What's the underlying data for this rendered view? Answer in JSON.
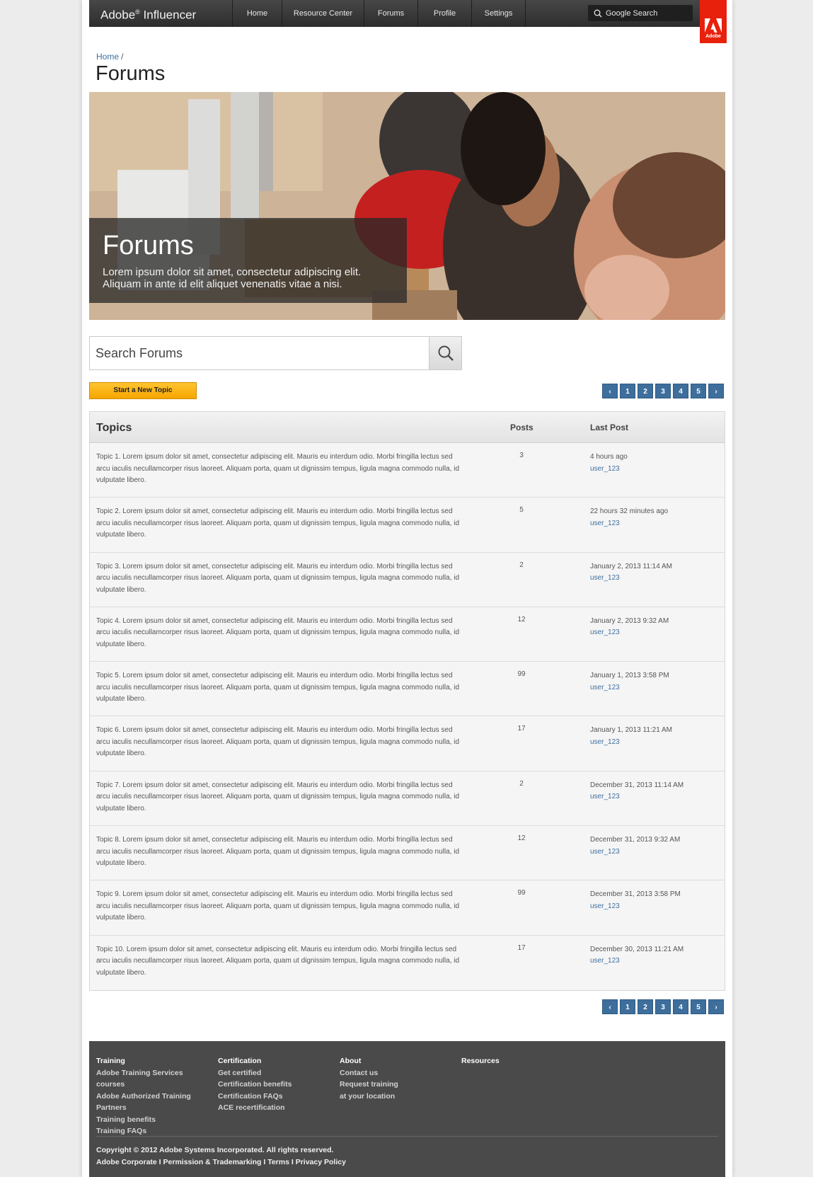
{
  "topbar": {
    "brand": "Adobe",
    "brand_reg": "®",
    "brand_suffix": " Influencer",
    "nav": [
      "Home",
      "Resource Center",
      "Forums",
      "Profile",
      "Settings"
    ],
    "search_label": "Google Search",
    "adobe_badge": "Adobe"
  },
  "breadcrumb": {
    "home": "Home",
    "separator": "/"
  },
  "page_title": "Forums",
  "hero": {
    "title": "Forums",
    "text": "Lorem ipsum dolor sit amet, consectetur adipiscing elit. Aliquam in ante id elit aliquet venenatis vitae a nisi."
  },
  "search": {
    "placeholder": "Search Forums"
  },
  "new_topic_label": "Start a New Topic",
  "pager": {
    "prev": "‹",
    "pages": [
      "1",
      "2",
      "3",
      "4",
      "5"
    ],
    "next": "›"
  },
  "table": {
    "headers": {
      "topics": "Topics",
      "posts": "Posts",
      "last_post": "Last Post"
    },
    "rows": [
      {
        "topic": "Topic 1. Lorem ipsum dolor sit amet, consectetur adipiscing elit. Mauris eu interdum odio. Morbi fringilla lectus sed arcu iaculis necullamcorper risus laoreet. Aliquam porta, quam ut dignissim tempus, ligula magna commodo nulla, id vulputate libero.",
        "posts": "3",
        "time": "4 hours ago",
        "user": "user_123"
      },
      {
        "topic": "Topic 2. Lorem ipsum dolor sit amet, consectetur adipiscing elit. Mauris eu interdum odio. Morbi fringilla lectus sed arcu iaculis necullamcorper risus laoreet. Aliquam porta, quam ut dignissim tempus, ligula magna commodo nulla, id vulputate libero.",
        "posts": "5",
        "time": "22 hours 32 minutes ago",
        "user": "user_123"
      },
      {
        "topic": "Topic 3. Lorem ipsum dolor sit amet, consectetur adipiscing elit. Mauris eu interdum odio. Morbi fringilla lectus sed arcu iaculis necullamcorper risus laoreet. Aliquam porta, quam ut dignissim tempus, ligula magna commodo nulla, id vulputate libero.",
        "posts": "2",
        "time": "January 2, 2013 11:14 AM",
        "user": "user_123"
      },
      {
        "topic": "Topic 4. Lorem ipsum dolor sit amet, consectetur adipiscing elit. Mauris eu interdum odio. Morbi fringilla lectus sed arcu iaculis necullamcorper risus laoreet. Aliquam porta, quam ut dignissim tempus, ligula magna commodo nulla, id vulputate libero.",
        "posts": "12",
        "time": "January 2, 2013 9:32 AM",
        "user": "user_123"
      },
      {
        "topic": "Topic 5. Lorem ipsum dolor sit amet, consectetur adipiscing elit. Mauris eu interdum odio. Morbi fringilla lectus sed arcu iaculis necullamcorper risus laoreet. Aliquam porta, quam ut dignissim tempus, ligula magna commodo nulla, id vulputate libero.",
        "posts": "99",
        "time": "January 1, 2013 3:58 PM",
        "user": "user_123"
      },
      {
        "topic": "Topic 6. Lorem ipsum dolor sit amet, consectetur adipiscing elit. Mauris eu interdum odio. Morbi fringilla lectus sed arcu iaculis necullamcorper risus laoreet. Aliquam porta, quam ut dignissim tempus, ligula magna commodo nulla, id vulputate libero.",
        "posts": "17",
        "time": "January 1, 2013 11:21 AM",
        "user": "user_123"
      },
      {
        "topic": "Topic 7. Lorem ipsum dolor sit amet, consectetur adipiscing elit. Mauris eu interdum odio. Morbi fringilla lectus sed arcu iaculis necullamcorper risus laoreet. Aliquam porta, quam ut dignissim tempus, ligula magna commodo nulla, id vulputate libero.",
        "posts": "2",
        "time": "December 31, 2013 11:14 AM",
        "user": "user_123"
      },
      {
        "topic": "Topic 8. Lorem ipsum dolor sit amet, consectetur adipiscing elit. Mauris eu interdum odio. Morbi fringilla lectus sed arcu iaculis necullamcorper risus laoreet. Aliquam porta, quam ut dignissim tempus, ligula magna commodo nulla, id vulputate libero.",
        "posts": "12",
        "time": "December 31, 2013 9:32 AM",
        "user": "user_123"
      },
      {
        "topic": "Topic 9. Lorem ipsum dolor sit amet, consectetur adipiscing elit. Mauris eu interdum odio. Morbi fringilla lectus sed arcu iaculis necullamcorper risus laoreet. Aliquam porta, quam ut dignissim tempus, ligula magna commodo nulla, id vulputate libero.",
        "posts": "99",
        "time": "December 31, 2013 3:58 PM",
        "user": "user_123"
      },
      {
        "topic": "Topic 10. Lorem ipsum dolor sit amet, consectetur adipiscing elit. Mauris eu interdum odio. Morbi fringilla lectus sed arcu iaculis necullamcorper risus laoreet. Aliquam porta, quam ut dignissim tempus, ligula magna commodo nulla, id vulputate libero.",
        "posts": "17",
        "time": "December 30, 2013 11:21 AM",
        "user": "user_123"
      }
    ]
  },
  "footer": {
    "training": {
      "heading": "Training",
      "links": [
        "Adobe Training Services courses",
        "Adobe Authorized Training Partners",
        "Training benefits",
        "Training FAQs"
      ]
    },
    "certification": {
      "heading": "Certification",
      "links": [
        "Get certified",
        "Certification benefits",
        "Certification FAQs",
        "ACE recertification"
      ]
    },
    "about": {
      "heading": "About",
      "links": [
        "Contact us",
        "Request training at your location"
      ]
    },
    "resources": {
      "heading": "Resources"
    },
    "copyright": "Copyright © 2012 Adobe Systems Incorporated. All rights reserved.",
    "legal_links": [
      "Adobe Corporate",
      "Permission & Trademarking",
      "Terms",
      "Privacy Policy"
    ],
    "legal_separator": " I "
  },
  "colors": {
    "accent_red": "#e8210d",
    "link_blue": "#3f6f9c",
    "button_yellow": "#fcb815",
    "pager_blue": "#3e6e9c"
  }
}
